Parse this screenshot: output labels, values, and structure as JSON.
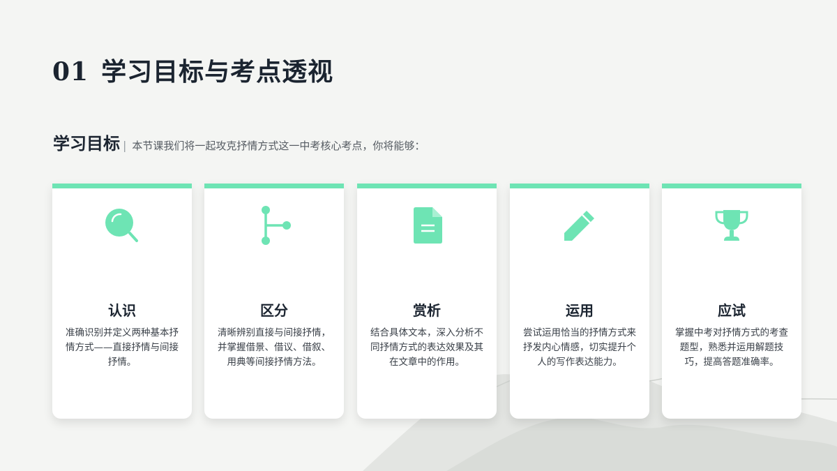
{
  "heading": {
    "number": "01",
    "text": "学习目标与考点透视"
  },
  "objectives": {
    "label": "学习目标",
    "separator": "|",
    "intro": "本节课我们将一起攻克抒情方式这一中考核心考点，你将能够："
  },
  "theme": {
    "accent": "#6ee4b4",
    "text_dark": "#1b2430"
  },
  "cards": [
    {
      "icon": "search-icon",
      "title": "认识",
      "desc": "准确识别并定义两种基本抒情方式——直接抒情与间接抒情。"
    },
    {
      "icon": "branch-icon",
      "title": "区分",
      "desc": "清晰辨别直接与间接抒情，并掌握借景、借议、借叙、用典等间接抒情方法。"
    },
    {
      "icon": "document-icon",
      "title": "赏析",
      "desc": "结合具体文本，深入分析不同抒情方式的表达效果及其在文章中的作用。"
    },
    {
      "icon": "pencil-icon",
      "title": "运用",
      "desc": "尝试运用恰当的抒情方式来抒发内心情感，切实提升个人的写作表达能力。"
    },
    {
      "icon": "trophy-icon",
      "title": "应试",
      "desc": "掌握中考对抒情方式的考查题型，熟悉并运用解题技巧，提高答题准确率。"
    }
  ]
}
